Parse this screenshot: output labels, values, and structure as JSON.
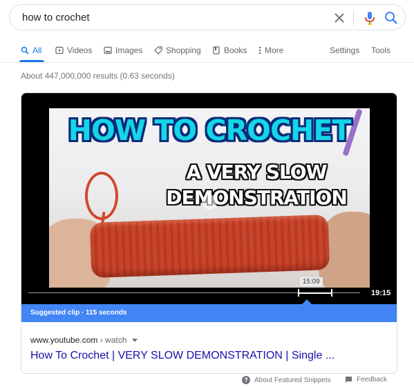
{
  "search": {
    "query": "how to crochet"
  },
  "tabs": [
    {
      "label": "All"
    },
    {
      "label": "Videos"
    },
    {
      "label": "Images"
    },
    {
      "label": "Shopping"
    },
    {
      "label": "Books"
    },
    {
      "label": "More"
    }
  ],
  "tools": {
    "settings": "Settings",
    "tools": "Tools"
  },
  "stats": "About 447,000,000 results (0.63 seconds)",
  "video": {
    "thumb_title": "HOW TO CROCHET",
    "thumb_sub1": "A VERY SLOW",
    "thumb_sub2": "DEMONSTRATION",
    "clip_time": "15:09",
    "duration": "19:15",
    "clip_start_fraction": 0.814,
    "clip_end_fraction": 0.914
  },
  "suggested": "Suggested clip · 115 seconds",
  "source": {
    "site": "www.youtube.com",
    "crumb": " › watch"
  },
  "result_title": "How To Crochet | VERY SLOW DEMONSTRATION | Single ...",
  "footer": {
    "about": "About Featured Snippets",
    "feedback": "Feedback"
  },
  "colors": {
    "accent": "#1a73e8",
    "link": "#1a0dab",
    "suggested_bg": "#4285f4"
  }
}
